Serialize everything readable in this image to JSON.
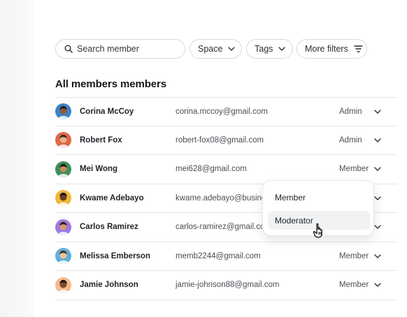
{
  "toolbar": {
    "search_placeholder": "Search member",
    "space_label": "Space",
    "tags_label": "Tags",
    "more_filters_label": "More filters"
  },
  "section_title": "All members members",
  "members": [
    {
      "name": "Corina McCoy",
      "email": "corina.mccoy@gmail.com",
      "role": "Admin",
      "avatar_bg": "#3b82c4"
    },
    {
      "name": "Robert Fox",
      "email": "robert-fox08@gmail.com",
      "role": "Admin",
      "avatar_bg": "#e0674a"
    },
    {
      "name": "Mei Wong",
      "email": "mei628@gmail.com",
      "role": "Member",
      "avatar_bg": "#3e8f5a"
    },
    {
      "name": "Kwame Adebayo",
      "email": "kwame.adebayo@business",
      "role": "",
      "avatar_bg": "#f0b83c"
    },
    {
      "name": "Carlos Ramirez",
      "email": "carlos-ramirez@gmail.com",
      "role": "",
      "avatar_bg": "#9b7be0"
    },
    {
      "name": "Melissa Emberson",
      "email": "memb2244@gmail.com",
      "role": "Member",
      "avatar_bg": "#5fb0d8"
    },
    {
      "name": "Jamie Johnson",
      "email": "jamie-johnson88@gmail.com",
      "role": "Member",
      "avatar_bg": "#f2b98c"
    }
  ],
  "role_dropdown": {
    "options": [
      "Member",
      "Moderator"
    ],
    "hovered": "Moderator"
  },
  "icons": {
    "search": "search-icon",
    "chevron": "chevron-down-icon",
    "filter": "filter-lines-icon",
    "cursor": "hand-pointer-icon"
  }
}
